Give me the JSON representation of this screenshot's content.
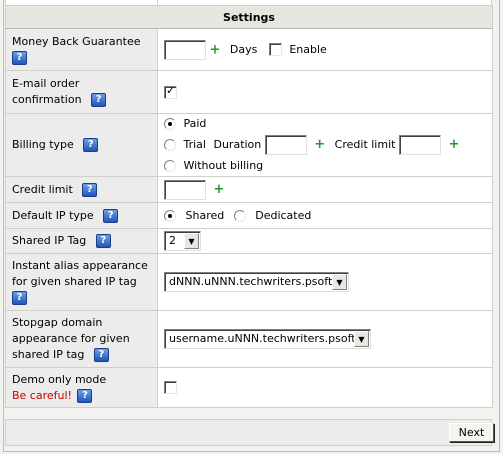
{
  "header": {
    "title": "Settings"
  },
  "rows": {
    "money_back": {
      "label": "Money Back Guarantee",
      "days_label": "Days",
      "enable_label": "Enable",
      "days_value": "",
      "enabled": false
    },
    "email_confirm": {
      "label_1": "E-mail order",
      "label_2": "confirmation",
      "checked": true
    },
    "billing": {
      "label": "Billing type",
      "paid_label": "Paid",
      "trial_label": "Trial",
      "duration_label": "Duration",
      "credit_limit_label": "Credit limit",
      "without_billing_label": "Without billing",
      "selected": "Paid"
    },
    "credit_limit": {
      "label": "Credit limit",
      "value": ""
    },
    "default_ip": {
      "label": "Default IP type",
      "shared_label": "Shared",
      "dedicated_label": "Dedicated",
      "selected": "Shared"
    },
    "shared_ip_tag": {
      "label": "Shared IP Tag",
      "value": "2"
    },
    "instant_alias": {
      "label_1": "Instant alias appearance",
      "label_2": "for given shared IP tag",
      "value": "dNNN.uNNN.techwriters.psoft"
    },
    "stopgap": {
      "label_1": "Stopgap domain",
      "label_2": "appearance for given",
      "label_3": "shared IP tag",
      "value": "username.uNNN.techwriters.psoft"
    },
    "demo_mode": {
      "label": "Demo only mode",
      "warning": "Be careful!",
      "warning_color": "#cc0000",
      "checked": false
    }
  },
  "icons": {
    "help": "help-question-icon",
    "add": "plus-icon"
  },
  "help_icon_text": "?",
  "plus_text": "+",
  "dropdown_arrow": "▼",
  "footer": {
    "next_label": "Next"
  }
}
